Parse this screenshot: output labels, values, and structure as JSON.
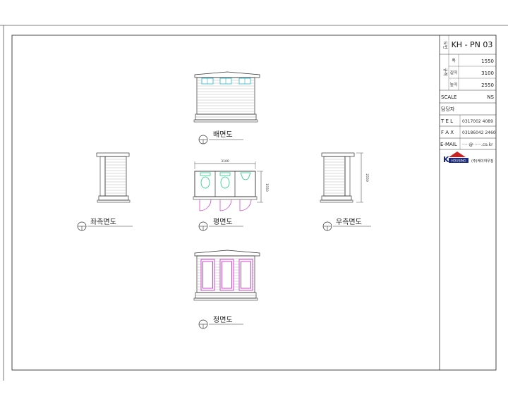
{
  "drawing_no": "KH - PN 03",
  "specs": [
    {
      "label": "폭",
      "value": "1550"
    },
    {
      "label": "길이",
      "value": "3100"
    },
    {
      "label": "높이",
      "value": "2550"
    }
  ],
  "scale": {
    "label": "SCALE",
    "value": "NS"
  },
  "manager_label": "담당자",
  "tel": {
    "label": "T E L",
    "value": "0317002 4089"
  },
  "fax": {
    "label": "F A X",
    "value": "03186042 2460"
  },
  "email": {
    "label": "E-MAIL",
    "value": "·····@······.co.kr"
  },
  "logo_text": "K HOUSING",
  "company": "(주)케이하우징",
  "views": {
    "rear": "배면도",
    "left": "좌측면도",
    "plan": "평면도",
    "right": "우측면도",
    "front": "정면도"
  },
  "dimensions": {
    "plan_width": "3100",
    "plan_depth": "1550",
    "right_height": "2550"
  },
  "colors": {
    "door": "#cc33cc",
    "fixture": "#22cc88",
    "window": "#22bbcc",
    "line": "#333333"
  }
}
